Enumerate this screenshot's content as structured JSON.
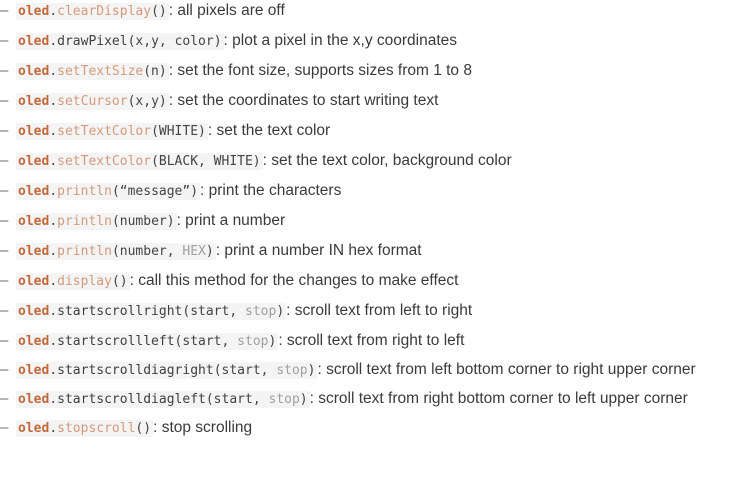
{
  "items": [
    {
      "obj": "oled",
      "dot": ".",
      "method": "clearDisplay",
      "args_pre": "()",
      "args_light": "",
      "args_post": "",
      "sep": ":",
      "desc": " all pixels are off"
    },
    {
      "obj": "oled",
      "dot": ".",
      "method": "drawPixel",
      "args_pre": "(x,y, ",
      "args_light": "",
      "args_post": "color)",
      "sep": ":",
      "desc": " plot a pixel in the x,y coordinates"
    },
    {
      "obj": "oled",
      "dot": ".",
      "method": "setTextSize",
      "args_pre": "(n)",
      "args_light": "",
      "args_post": "",
      "sep": ":",
      "desc": " set the font size, supports sizes from 1 to 8"
    },
    {
      "obj": "oled",
      "dot": ".",
      "method": "setCursor",
      "args_pre": "(x,y)",
      "args_light": "",
      "args_post": "",
      "sep": ":",
      "desc": " set the coordinates to start writing text"
    },
    {
      "obj": "oled",
      "dot": ".",
      "method": "setTextColor",
      "args_pre": "(WHITE)",
      "args_light": "",
      "args_post": "",
      "sep": ":",
      "desc": " set the text color"
    },
    {
      "obj": "oled",
      "dot": ".",
      "method": "setTextColor",
      "args_pre": "(BLACK, WHITE)",
      "args_light": "",
      "args_post": "",
      "sep": ":",
      "desc": " set the text color, background color"
    },
    {
      "obj": "oled",
      "dot": ".",
      "method": "println",
      "args_pre": "(“message”)",
      "args_light": "",
      "args_post": "",
      "sep": ":",
      "desc": " print the characters"
    },
    {
      "obj": "oled",
      "dot": ".",
      "method": "println",
      "args_pre": "(number)",
      "args_light": "",
      "args_post": "",
      "sep": ":",
      "desc": " print a number"
    },
    {
      "obj": "oled",
      "dot": ".",
      "method": "println",
      "args_pre": "(number, ",
      "args_light": "HEX",
      "args_post": ")",
      "sep": ":",
      "desc": " print a number IN hex format"
    },
    {
      "obj": "oled",
      "dot": ".",
      "method": "display",
      "args_pre": "()",
      "args_light": "",
      "args_post": "",
      "sep": ":",
      "desc": " call this method for the changes to make effect"
    },
    {
      "obj": "oled",
      "dot": ".",
      "method": "startscrollright",
      "args_pre": "(start, ",
      "args_light": "stop",
      "args_post": ")",
      "sep": ":",
      "desc": " scroll text from left to right"
    },
    {
      "obj": "oled",
      "dot": ".",
      "method": "startscrollleft",
      "args_pre": "(start, ",
      "args_light": "stop",
      "args_post": ")",
      "sep": ":",
      "desc": " scroll text from right to left"
    },
    {
      "obj": "oled",
      "dot": ".",
      "method": "startscrolldiagright",
      "args_pre": "(start, ",
      "args_light": "stop",
      "args_post": ")",
      "sep": ":",
      "desc": " scroll text from left bottom corner to right upper corner"
    },
    {
      "obj": "oled",
      "dot": ".",
      "method": "startscrolldiagleft",
      "args_pre": "(start, ",
      "args_light": "stop",
      "args_post": ")",
      "sep": ":",
      "desc": " scroll text from right bottom corner to left upper corner"
    },
    {
      "obj": "oled",
      "dot": ".",
      "method": "stopscroll",
      "args_pre": "()",
      "args_light": "",
      "args_post": "",
      "sep": ":",
      "desc": " stop scrolling"
    }
  ],
  "bullet": "–"
}
